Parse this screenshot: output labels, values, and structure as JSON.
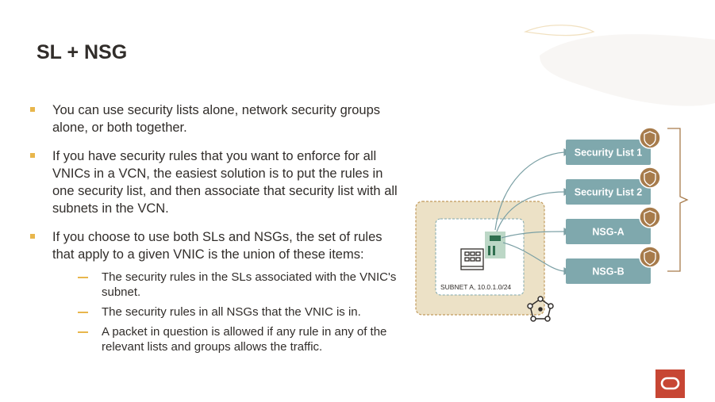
{
  "slide": {
    "title": "SL + NSG",
    "bullets": [
      {
        "text": "You can use security lists alone, network security groups alone, or both together."
      },
      {
        "text": "If you have security rules that you want to enforce for all VNICs in a VCN, the easiest solution is to put the rules in one security list, and then associate that security list with all subnets in the VCN."
      },
      {
        "text": "If you choose to use both SLs and NSGs, the set of rules that apply to a given VNIC is the union of these items:"
      }
    ],
    "sub_bullets": [
      {
        "text": "The security rules in the SLs associated with the VNIC's subnet."
      },
      {
        "text": "The security rules in all NSGs that the VNIC is in."
      },
      {
        "text": "A packet in question is allowed if any rule in any of the relevant lists and groups allows the traffic."
      }
    ]
  },
  "diagram": {
    "subnet_label": "SUBNET A, 10.0.1.0/24",
    "targets": [
      {
        "label": "Security List 1"
      },
      {
        "label": "Security List 2"
      },
      {
        "label": "NSG-A"
      },
      {
        "label": "NSG-B"
      }
    ]
  },
  "icons": [
    "shield-icon",
    "vcn-network-icon",
    "compute-instance-icon",
    "vnic-icon",
    "oracle-logo"
  ],
  "colors": {
    "accent": "#e8b64c",
    "target_box": "#7fa8ad",
    "subnet_fill": "#ece1c6",
    "subnet_border": "#c19a5b",
    "shield": "#a77b4b",
    "logo": "#c74634"
  }
}
